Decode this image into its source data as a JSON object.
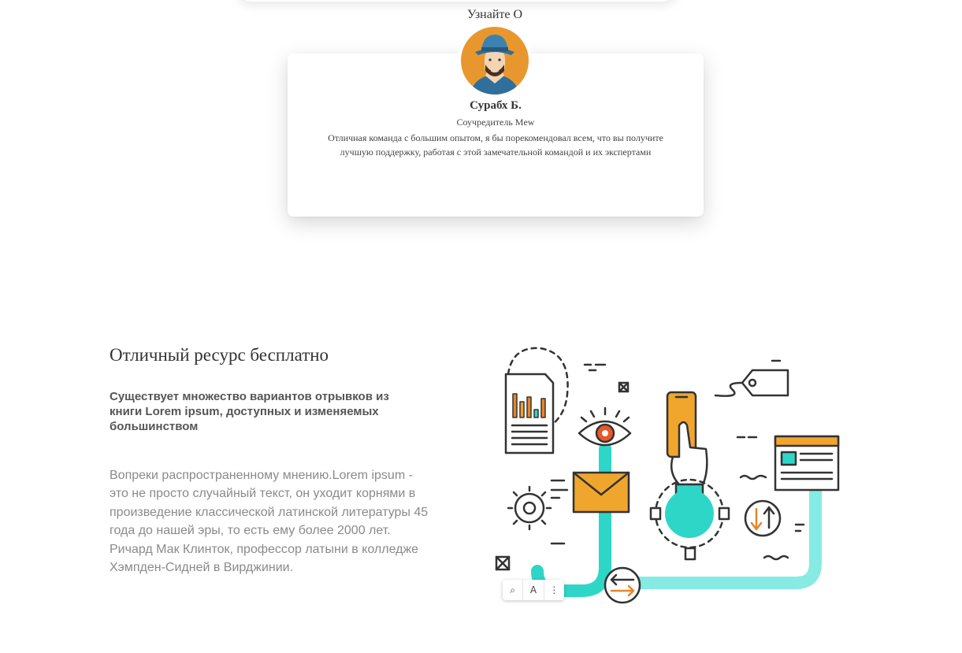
{
  "testimonial": {
    "section_title": "Узнайте О",
    "name": "Сурабх Б.",
    "role": "Соучредитель Mew",
    "quote": "Отличная команда с большим опытом, я бы порекомендовал всем, что вы получите лучшую поддержку, работая с этой замечательной командой и их экспертами",
    "avatar_icon": "man-avatar-icon"
  },
  "feature": {
    "title": "Отличный ресурс бесплатно",
    "subtitle": "Существует множество вариантов отрывков из книги Lorem ipsum, доступных и изменяемых большинством",
    "body": "Вопреки распространенному мнению.Lorem ipsum - это не просто случайный текст, он уходит корнями в произведение классической латинской литературы 45 года до нашей эры, то есть ему более 2000 лет. Ричард Мак Клинток, профессор латыни в колледже Хэмпден-Сидней в Вирджинии."
  },
  "image_toolbar": {
    "buttons": [
      {
        "icon": "camera-search-icon",
        "glyph": "⌕"
      },
      {
        "icon": "translate-icon",
        "glyph": "A"
      },
      {
        "icon": "more-vert-icon",
        "glyph": "⋮"
      }
    ]
  },
  "colors": {
    "accent_teal": "#2ed6c8",
    "accent_orange": "#f0a52c",
    "outline": "#333333"
  }
}
